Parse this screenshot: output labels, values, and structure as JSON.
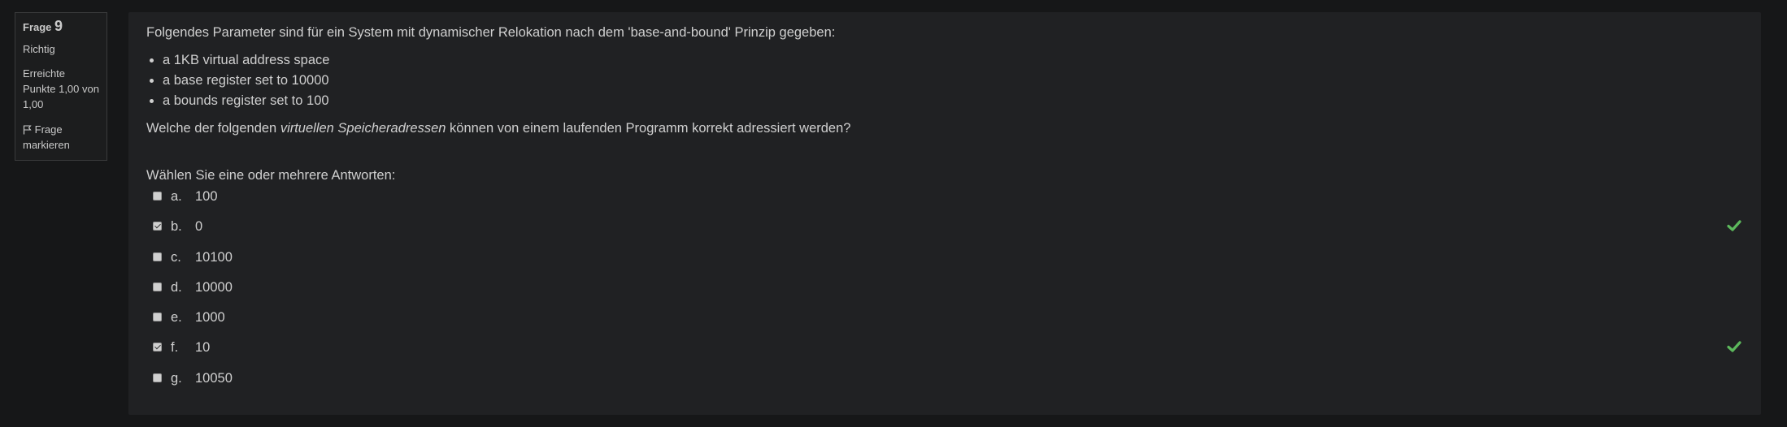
{
  "info": {
    "question_label": "Frage",
    "question_number": "9",
    "state": "Richtig",
    "grade": "Erreichte Punkte 1,00 von 1,00",
    "flag_label": "Frage markieren"
  },
  "question": {
    "intro": "Folgendes Parameter sind für ein System mit dynamischer Relokation nach dem 'base-and-bound' Prinzip gegeben:",
    "bullets": [
      "a 1KB virtual address space",
      "a base register set to 10000",
      "a bounds register set to 100"
    ],
    "text_before": "Welche der folgenden ",
    "text_emphasis": "virtuellen Speicheradressen",
    "text_after": " können von einem laufenden Programm korrekt adressiert werden?",
    "prompt": "Wählen Sie eine oder mehrere Antworten:"
  },
  "answers": [
    {
      "letter": "a.",
      "value": "100",
      "checked": false,
      "correct_mark": false
    },
    {
      "letter": "b.",
      "value": "0",
      "checked": true,
      "correct_mark": true
    },
    {
      "letter": "c.",
      "value": "10100",
      "checked": false,
      "correct_mark": false
    },
    {
      "letter": "d.",
      "value": "10000",
      "checked": false,
      "correct_mark": false
    },
    {
      "letter": "e.",
      "value": "1000",
      "checked": false,
      "correct_mark": false
    },
    {
      "letter": "f.",
      "value": "10",
      "checked": true,
      "correct_mark": true
    },
    {
      "letter": "g.",
      "value": "10050",
      "checked": false,
      "correct_mark": false
    }
  ],
  "colors": {
    "background": "#161718",
    "panel": "#202123",
    "text": "#cfcfcf",
    "correct_tick": "#5cb85c"
  },
  "icons": {
    "flag": "flag-icon",
    "tick": "check-icon"
  }
}
